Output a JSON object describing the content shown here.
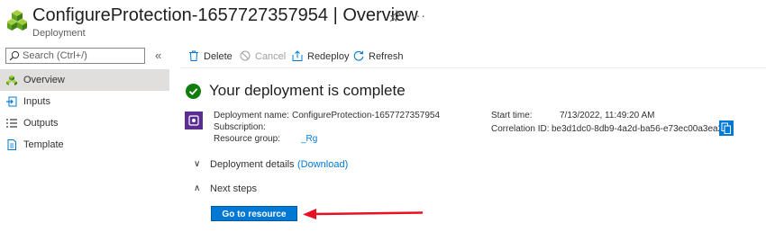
{
  "header": {
    "title": "ConfigureProtection-1657727357954",
    "separator": " | ",
    "section": "Overview",
    "subtitle": "Deployment",
    "more": "···"
  },
  "sidebar": {
    "search_placeholder": "Search (Ctrl+/)",
    "collapse": "«",
    "items": [
      {
        "label": "Overview",
        "icon": "deployment-icon",
        "active": true
      },
      {
        "label": "Inputs",
        "icon": "inputs-icon"
      },
      {
        "label": "Outputs",
        "icon": "outputs-icon"
      },
      {
        "label": "Template",
        "icon": "template-icon"
      }
    ]
  },
  "toolbar": {
    "delete": "Delete",
    "cancel": "Cancel",
    "redeploy": "Redeploy",
    "refresh": "Refresh"
  },
  "main": {
    "heading": "Your deployment is complete",
    "details_left": {
      "name_label": "Deployment name:",
      "name_value": "ConfigureProtection-1657727357954",
      "subscription_label": "Subscription:",
      "subscription_value": "",
      "rg_label": "Resource group:",
      "rg_value": "_Rg"
    },
    "details_right": {
      "start_label": "Start time:",
      "start_value": "7/13/2022, 11:49:20 AM",
      "corr_label": "Correlation ID:",
      "corr_value": "be3d1dc0-8db9-4a2d-ba56-e73ec00a3ea2"
    },
    "deployment_details": "Deployment details",
    "download": "(Download)",
    "next_steps": "Next steps",
    "go_to_resource": "Go to resource",
    "chevron_down": "∨",
    "chevron_up": "∧"
  },
  "colors": {
    "accent": "#0078d4",
    "success": "#107c10",
    "arrow": "#e81123",
    "nav_active": "#e1dfdd"
  }
}
